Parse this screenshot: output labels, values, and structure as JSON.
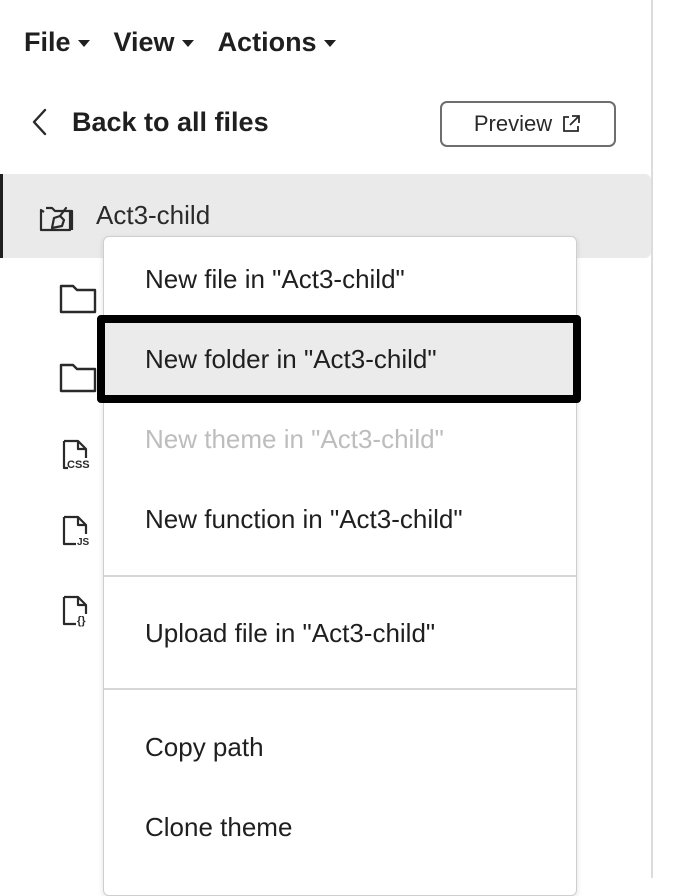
{
  "menubar": {
    "items": [
      {
        "label": "File"
      },
      {
        "label": "View"
      },
      {
        "label": "Actions"
      }
    ]
  },
  "nav": {
    "back_label": "Back to all files",
    "preview_label": "Preview"
  },
  "tree": {
    "root_label": "Act3-child",
    "children": [
      {
        "icon": "folder-icon"
      },
      {
        "icon": "folder-icon"
      },
      {
        "icon": "css-file-icon",
        "badge": "CSS"
      },
      {
        "icon": "js-file-icon",
        "badge": "JS"
      },
      {
        "icon": "json-file-icon",
        "badge": "{}"
      }
    ]
  },
  "context_menu": {
    "items": [
      {
        "label": "New file in \"Act3-child\"",
        "state": "normal"
      },
      {
        "label": "New folder in \"Act3-child\"",
        "state": "highlighted"
      },
      {
        "label": "New theme in \"Act3-child\"",
        "state": "disabled"
      },
      {
        "label": "New function in \"Act3-child\"",
        "state": "normal"
      },
      {
        "label": "Upload file in \"Act3-child\"",
        "state": "normal"
      },
      {
        "label": "Copy path",
        "state": "normal"
      },
      {
        "label": "Clone theme",
        "state": "normal"
      }
    ]
  },
  "colors": {
    "text": "#1f1f1f",
    "disabled_text": "#bdbdbd",
    "selected_row_bg": "#eaeaea",
    "highlight_border": "#000000"
  }
}
